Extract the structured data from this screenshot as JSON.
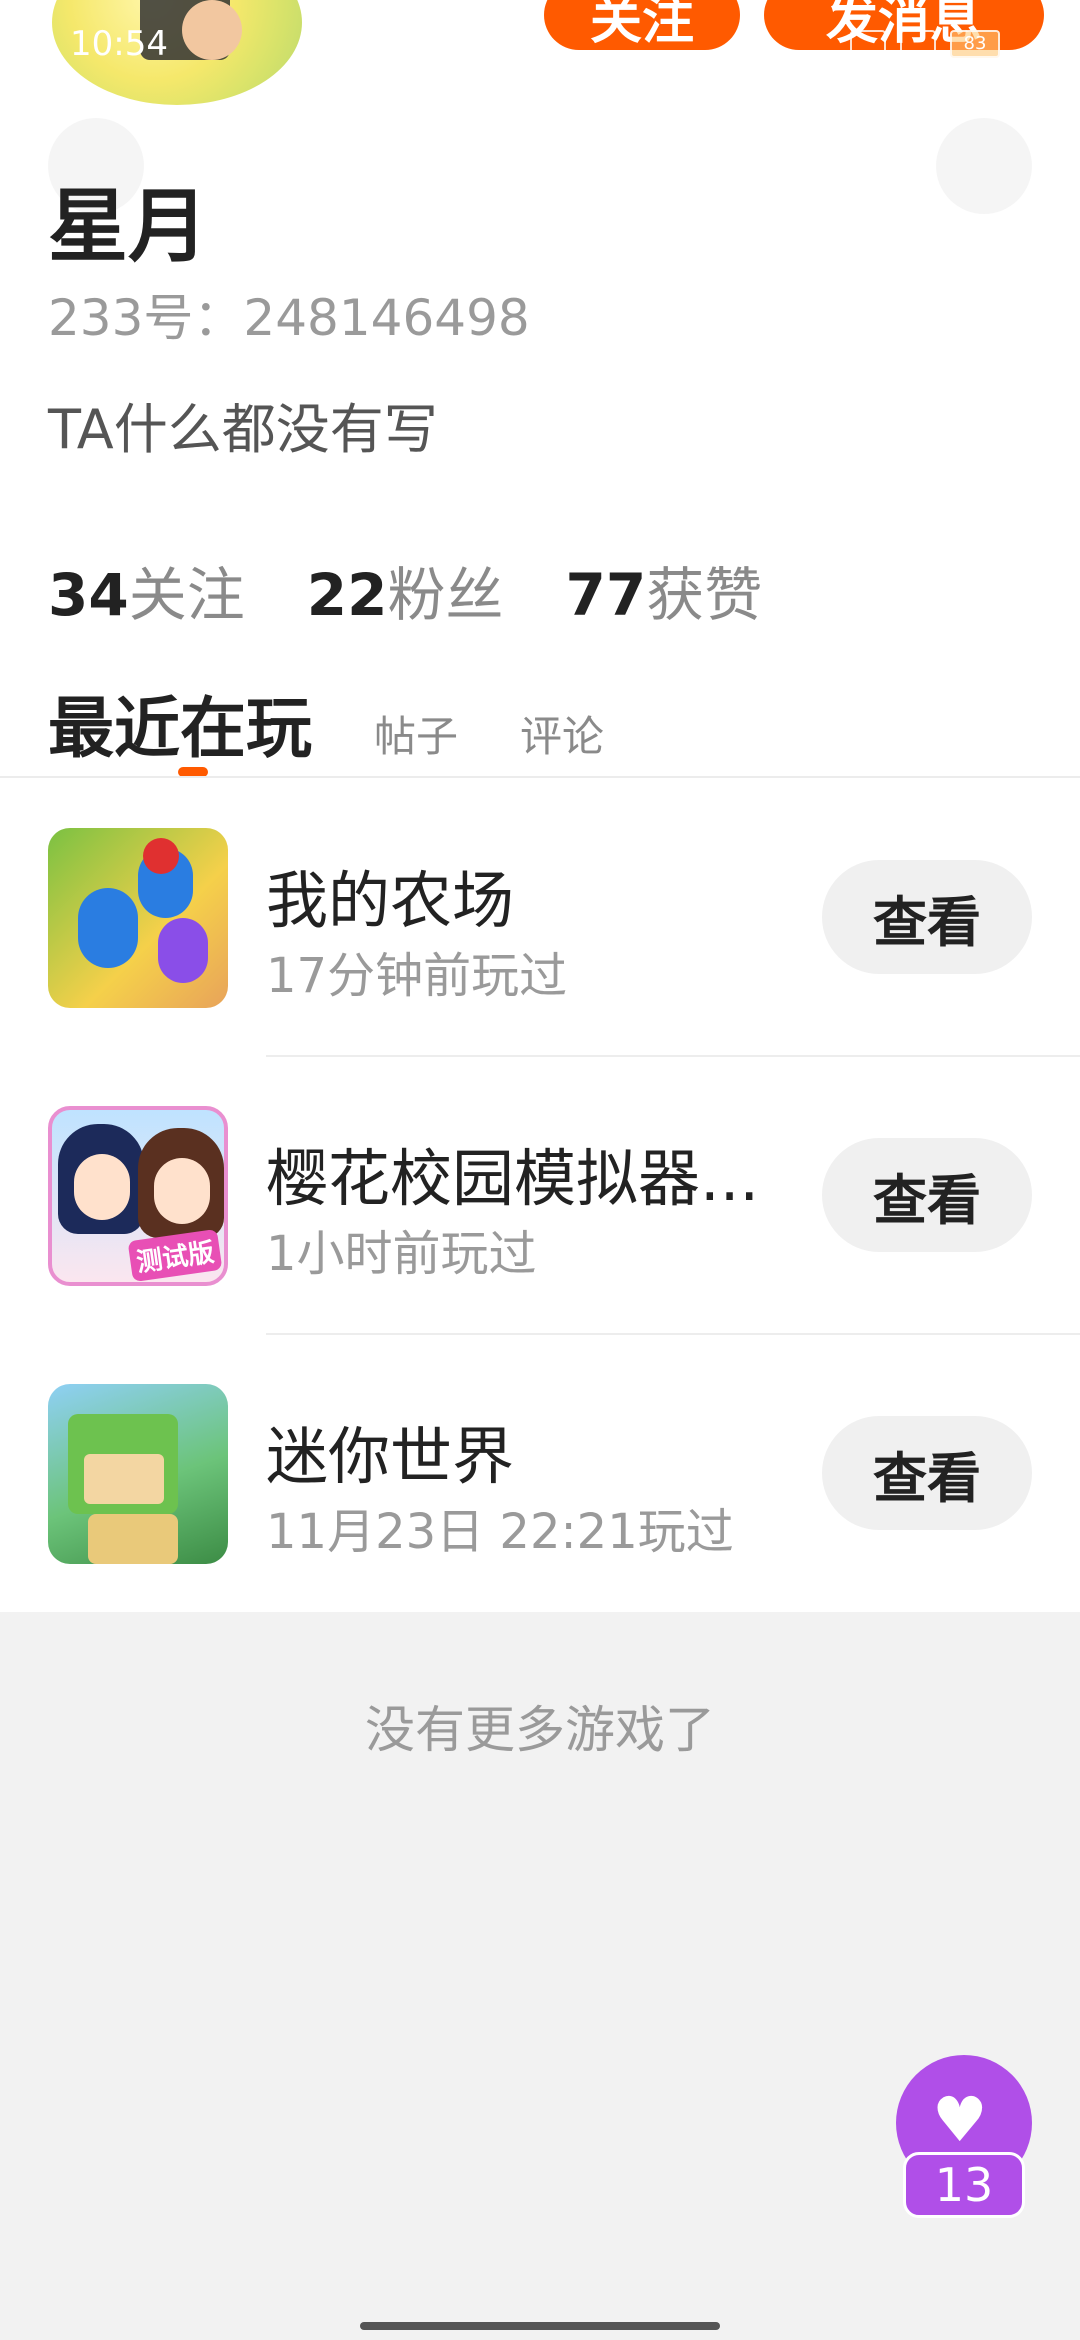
{
  "status_bar": {
    "time": "10:54",
    "battery": "83"
  },
  "header": {
    "follow_label": "关注",
    "message_label": "发消息"
  },
  "profile": {
    "name": "星月",
    "uid": "233号：248146498",
    "bio": "TA什么都没有写"
  },
  "stats": [
    {
      "num": "34",
      "label": "关注"
    },
    {
      "num": "22",
      "label": "粉丝"
    },
    {
      "num": "77",
      "label": "获赞"
    }
  ],
  "tabs": {
    "active": "最近在玩",
    "posts": "帖子",
    "comments": "评论"
  },
  "games": [
    {
      "title": "我的农场",
      "played": "17分钟前玩过",
      "view_label": "查看",
      "icon": "farm-game-icon"
    },
    {
      "title": "樱花校园模拟器...",
      "played": "1小时前玩过",
      "view_label": "查看",
      "icon": "sakura-school-icon",
      "badge": "测试版"
    },
    {
      "title": "迷你世界",
      "played": "11月23日 22:21玩过",
      "view_label": "查看",
      "icon": "mini-world-icon"
    }
  ],
  "footer_note": "没有更多游戏了",
  "like_fab": {
    "count": "13",
    "icon": "heart-icon",
    "color": "#b04fe8"
  },
  "colors": {
    "accent": "#ff5a00"
  }
}
